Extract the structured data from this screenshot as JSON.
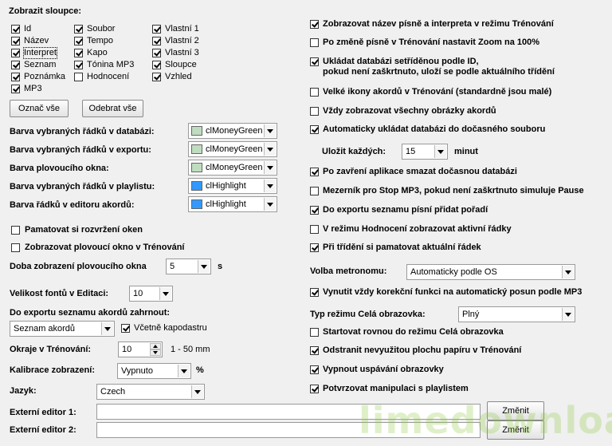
{
  "columns": {
    "title": "Zobrazit sloupce:",
    "items": [
      {
        "label": "Id",
        "checked": true
      },
      {
        "label": "Název",
        "checked": true
      },
      {
        "label": "Interpret",
        "checked": true
      },
      {
        "label": "Seznam",
        "checked": true
      },
      {
        "label": "Poznámka",
        "checked": true
      },
      {
        "label": "MP3",
        "checked": true
      },
      {
        "label": "Soubor",
        "checked": true
      },
      {
        "label": "Tempo",
        "checked": true
      },
      {
        "label": "Kapo",
        "checked": true
      },
      {
        "label": "Tónina MP3",
        "checked": true
      },
      {
        "label": "Hodnocení",
        "checked": false
      },
      {
        "label": "Vlastní 1",
        "checked": true
      },
      {
        "label": "Vlastní 2",
        "checked": true
      },
      {
        "label": "Vlastní 3",
        "checked": true
      },
      {
        "label": "Sloupce",
        "checked": true
      },
      {
        "label": "Vzhled",
        "checked": true
      }
    ],
    "select_all": "Označ vše",
    "deselect_all": "Odebrat vše"
  },
  "colors": [
    {
      "label": "Barva vybraných řádků v databázi:",
      "value": "clMoneyGreen",
      "swatch": "#c0dcc0"
    },
    {
      "label": "Barva vybraných řádků v exportu:",
      "value": "clMoneyGreen",
      "swatch": "#c0dcc0"
    },
    {
      "label": "Barva plovoucího okna:",
      "value": "clMoneyGreen",
      "swatch": "#c0dcc0"
    },
    {
      "label": "Barva vybraných řádků v playlistu:",
      "value": "clHighlight",
      "swatch": "#3399ff"
    },
    {
      "label": "Barva řádků v editoru akordů:",
      "value": "clHighlight",
      "swatch": "#3399ff"
    }
  ],
  "left_checks": [
    {
      "label": "Pamatovat si rozvržení oken",
      "checked": false
    },
    {
      "label": "Zobrazovat plovoucí okno v Trénování",
      "checked": false
    }
  ],
  "float_duration": {
    "label": "Doba zobrazení plovoucího okna",
    "value": "5",
    "unit": "s"
  },
  "font_size": {
    "label": "Velikost fontů v Editaci:",
    "value": "10"
  },
  "export": {
    "label": "Do exportu seznamu akordů zahrnout:",
    "value": "Seznam akordů",
    "capo_label": "Včetně kapodastru",
    "capo_checked": true
  },
  "margins": {
    "label": "Okraje v Trénování:",
    "value": "10",
    "range": "1 - 50 mm"
  },
  "calibration": {
    "label": "Kalibrace zobrazení:",
    "value": "Vypnuto",
    "unit": "%"
  },
  "language": {
    "label": "Jazyk:",
    "value": "Czech"
  },
  "ext_editor1": {
    "label": "Externí editor 1:",
    "value": "",
    "button": "Změnit"
  },
  "ext_editor2": {
    "label": "Externí editor 2:",
    "value": "",
    "button": "Změnit"
  },
  "right_checks_a": [
    {
      "label": "Zobrazovat název písně a interpreta v režimu Trénování",
      "checked": true
    },
    {
      "label": "Po změně písně v Trénování nastavit Zoom na 100%",
      "checked": false
    },
    {
      "label": "Ukládat databázi setříděnou podle ID,",
      "label2": "pokud není zaškrtnuto, uloží se podle aktuálního třídění",
      "checked": true
    },
    {
      "label": "Velké ikony akordů v Trénování (standardně jsou malé)",
      "checked": false
    },
    {
      "label": "Vždy zobrazovat všechny obrázky akordů",
      "checked": false
    },
    {
      "label": "Automaticky ukládat databázi do dočasného souboru",
      "checked": true
    }
  ],
  "autosave": {
    "label": "Uložit každých:",
    "value": "15",
    "unit": "minut"
  },
  "right_checks_b": [
    {
      "label": "Po zavření aplikace smazat dočasnou databázi",
      "checked": true
    },
    {
      "label": "Mezerník pro Stop MP3, pokud není zaškrtnuto simuluje Pause",
      "checked": false
    },
    {
      "label": "Do exportu seznamu písní přidat pořadí",
      "checked": true
    },
    {
      "label": "V režimu Hodnocení zobrazovat aktivní řádky",
      "checked": false
    },
    {
      "label": "Při třídění si pamatovat aktuální řádek",
      "checked": true
    }
  ],
  "metronome": {
    "label": "Volba metronomu:",
    "value": "Automaticky podle OS"
  },
  "right_check_c": {
    "label": "Vynutit vždy korekční funkci na automatický posun podle MP3",
    "checked": true
  },
  "fullscreen": {
    "label": "Typ režimu Celá obrazovka:",
    "value": "Plný"
  },
  "right_checks_d": [
    {
      "label": "Startovat rovnou do režimu Celá obrazovka",
      "checked": false
    },
    {
      "label": "Odstranit nevyužitou plochu papíru v Trénování",
      "checked": true
    },
    {
      "label": "Vypnout uspávání obrazovky",
      "checked": true
    },
    {
      "label": "Potvrzovat manipulaci s playlistem",
      "checked": true
    }
  ],
  "watermark": "limedownload.com"
}
